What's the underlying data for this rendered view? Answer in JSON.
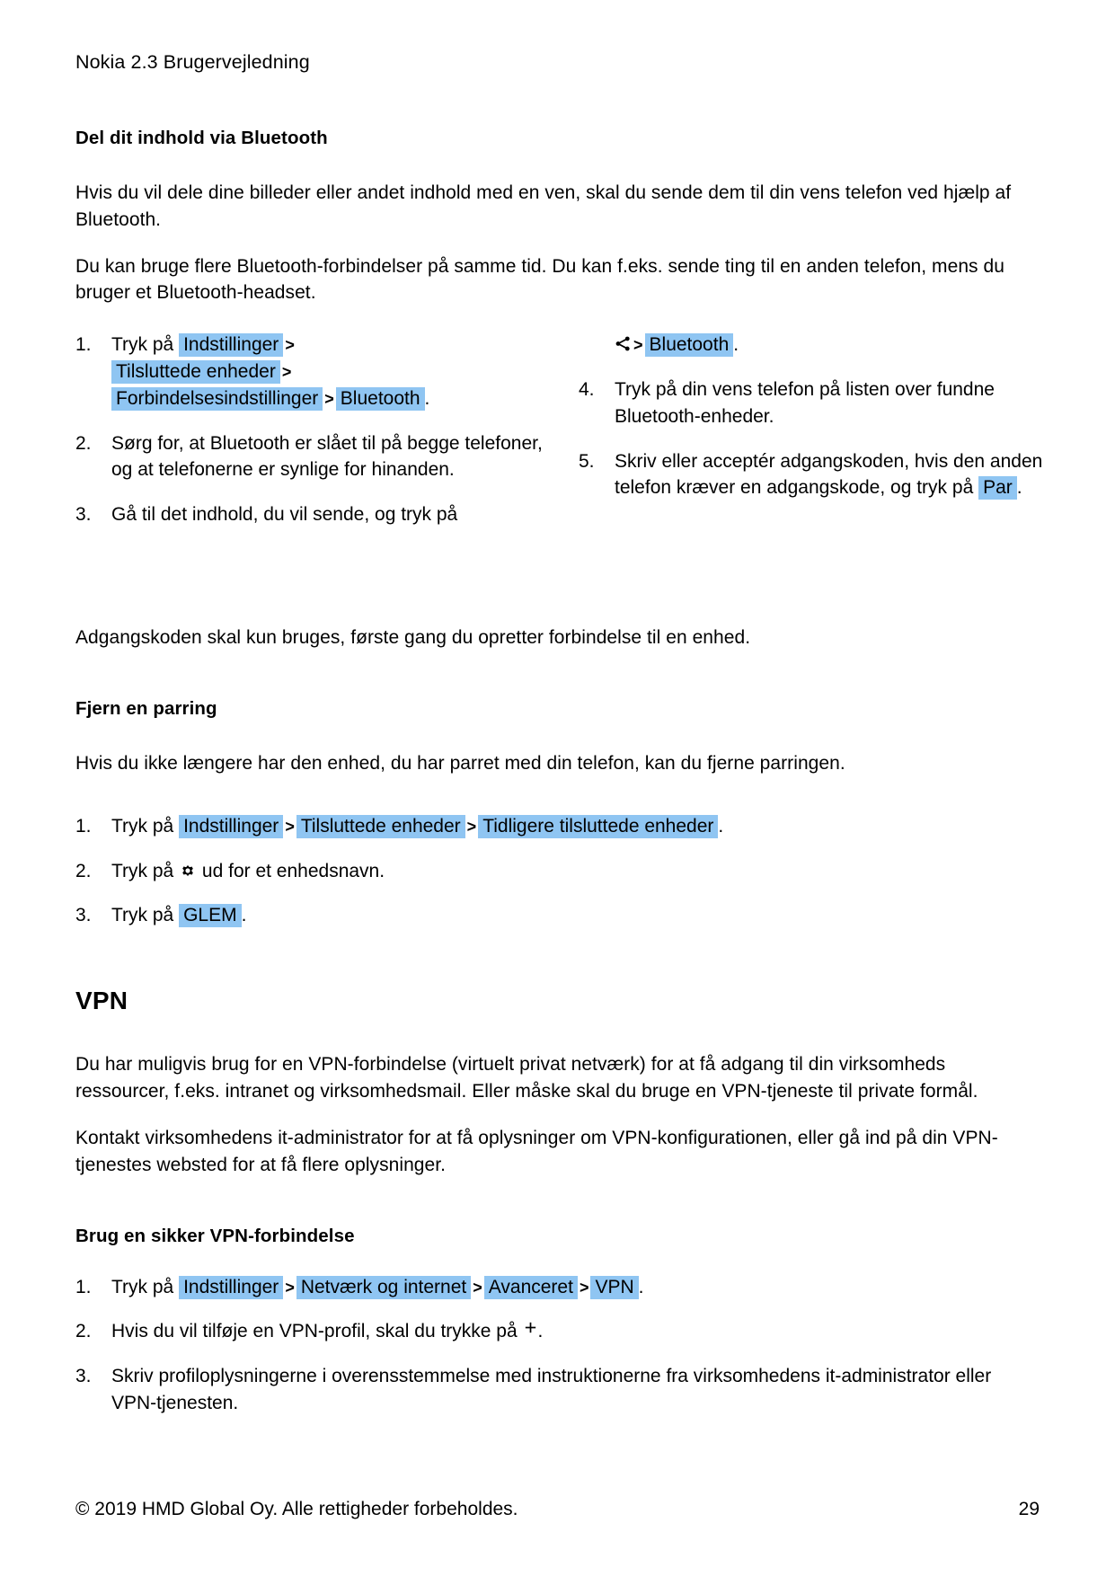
{
  "header": {
    "running_head": "Nokia 2.3 Brugervejledning"
  },
  "section_bluetooth": {
    "heading": "Del dit indhold via Bluetooth",
    "paragraph_1": "Hvis du vil dele dine billeder eller andet indhold med en ven, skal du sende dem til din vens telefon ved hjælp af Bluetooth.",
    "paragraph_2": "Du kan bruge flere Bluetooth-forbindelser på samme tid. Du kan f.eks. sende ting til en anden telefon, mens du bruger et Bluetooth-headset.",
    "step1": {
      "number": "1.",
      "lead": "Tryk på",
      "chip_1": "Indstillinger",
      "sep_1": ">",
      "chip_2": "Tilsluttede enheder",
      "sep_2": ">",
      "chip_3": "Forbindelsesindstillinger",
      "sep_3": ">",
      "chip_4": "Bluetooth",
      "period": "."
    },
    "step2": {
      "number": "2.",
      "text": "Sørg for, at Bluetooth er slået til på begge telefoner, og at telefonerne er synlige for hinanden."
    },
    "step3": {
      "number": "3.",
      "text": "Gå til det indhold, du vil sende, og tryk på",
      "icon": "share-icon",
      "sep": ">",
      "chip": "Bluetooth",
      "period": "."
    },
    "step4": {
      "number": "4.",
      "text": "Tryk på din vens telefon på listen over fundne Bluetooth-enheder."
    },
    "step5": {
      "number": "5.",
      "text_before": "Skriv eller acceptér adgangskoden, hvis den anden telefon kræver en adgangskode, og tryk på",
      "chip": "Par",
      "period": "."
    },
    "note": "Adgangskoden skal kun bruges, første gang du opretter forbindelse til en enhed."
  },
  "section_unpair": {
    "heading": "Fjern en parring",
    "paragraph": "Hvis du ikke længere har den enhed, du har parret med din telefon, kan du fjerne parringen.",
    "step1": {
      "number": "1.",
      "lead": "Tryk på",
      "chip_1": "Indstillinger",
      "sep_1": ">",
      "chip_2": "Tilsluttede enheder",
      "sep_2": ">",
      "chip_3": "Tidligere tilsluttede enheder",
      "period": "."
    },
    "step2": {
      "number": "2.",
      "lead": "Tryk på",
      "icon": "gear-icon",
      "tail": "ud for et enhedsnavn."
    },
    "step3": {
      "number": "3.",
      "lead": "Tryk på",
      "chip": "GLEM",
      "period": "."
    }
  },
  "section_vpn": {
    "heading": "VPN",
    "paragraph_1": "Du har muligvis brug for en VPN-forbindelse (virtuelt privat netværk) for at få adgang til din virksomheds ressourcer, f.eks. intranet og virksomhedsmail. Eller måske skal du bruge en VPN-tjeneste til private formål.",
    "paragraph_2": "Kontakt virksomhedens it-administrator for at få oplysninger om VPN-konfigurationen, eller gå ind på din VPN-tjenestes websted for at få flere oplysninger."
  },
  "section_vpn_secure": {
    "heading": "Brug en sikker VPN-forbindelse",
    "step1": {
      "number": "1.",
      "lead": "Tryk på",
      "chip_1": "Indstillinger",
      "sep_1": ">",
      "chip_2": "Netværk og internet",
      "sep_2": ">",
      "chip_3": "Avanceret",
      "sep_3": ">",
      "chip_4": "VPN",
      "period": "."
    },
    "step2": {
      "number": "2.",
      "lead": "Hvis du vil tilføje en VPN-profil, skal du trykke på",
      "icon": "plus-icon",
      "period": "."
    },
    "step3": {
      "number": "3.",
      "text": "Skriv profiloplysningerne i overensstemmelse med instruktionerne fra virksomhedens it-administrator eller VPN-tjenesten."
    }
  },
  "footer": {
    "copyright": "© 2019 HMD Global Oy. Alle rettigheder forbeholdes.",
    "page_number": "29"
  },
  "colors": {
    "highlight": "#8FC5F2",
    "text": "#000000",
    "background": "#FFFFFF"
  }
}
